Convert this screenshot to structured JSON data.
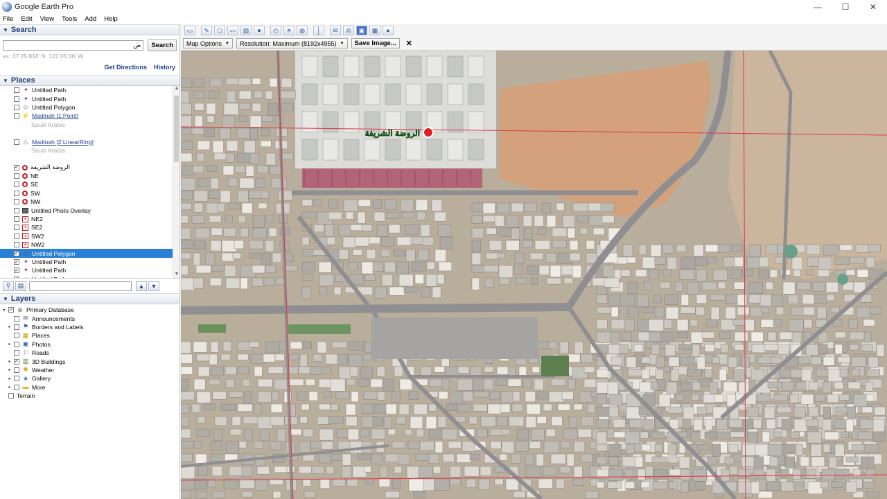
{
  "window": {
    "title": "Google Earth Pro",
    "minimize": "—",
    "maximize": "☐",
    "close": "✕"
  },
  "menu": [
    "File",
    "Edit",
    "View",
    "Tools",
    "Add",
    "Help"
  ],
  "search": {
    "header": "Search",
    "input_value": "ص",
    "button": "Search",
    "hint": "ex: 37 25.818' N, 122 05.36' W",
    "get_directions": "Get Directions",
    "history": "History"
  },
  "places": {
    "header": "Places",
    "items": [
      {
        "label": "Untitled Path",
        "icon": "path-icon",
        "checked": false,
        "style": "normal"
      },
      {
        "label": "Untitled Path",
        "icon": "path-icon",
        "checked": false,
        "style": "normal"
      },
      {
        "label": "Untitled Polygon",
        "icon": "polygon-icon",
        "checked": false,
        "style": "normal"
      },
      {
        "label": "Madinah [1:Point]",
        "icon": "point-icon",
        "checked": false,
        "style": "link"
      },
      {
        "label": "Saudi Arabia",
        "icon": "",
        "checked": null,
        "style": "gray"
      },
      {
        "label": "",
        "icon": "",
        "checked": null,
        "style": "gray"
      },
      {
        "label": "Madinah [2:LinearRing]",
        "icon": "ring-icon",
        "checked": false,
        "style": "link"
      },
      {
        "label": "Saudi Arabia",
        "icon": "",
        "checked": null,
        "style": "gray"
      },
      {
        "label": "",
        "icon": "",
        "checked": null,
        "style": "gray"
      },
      {
        "label": "الروضة الشريفة",
        "icon": "placemark-icon",
        "checked": true,
        "style": "normal"
      },
      {
        "label": "NE",
        "icon": "placemark-icon",
        "checked": false,
        "style": "normal"
      },
      {
        "label": "SE",
        "icon": "placemark-icon",
        "checked": false,
        "style": "normal"
      },
      {
        "label": "SW",
        "icon": "placemark-icon",
        "checked": false,
        "style": "normal"
      },
      {
        "label": "NW",
        "icon": "placemark-icon",
        "checked": false,
        "style": "normal"
      },
      {
        "label": "Untitled Photo Overlay",
        "icon": "photo-overlay-icon",
        "checked": false,
        "style": "normal"
      },
      {
        "label": "NE2",
        "icon": "square-marker-icon",
        "checked": false,
        "style": "normal"
      },
      {
        "label": "SE2",
        "icon": "square-marker-icon",
        "checked": false,
        "style": "normal"
      },
      {
        "label": "SW2",
        "icon": "square-marker-icon",
        "checked": false,
        "style": "normal"
      },
      {
        "label": "NW2",
        "icon": "square-marker-icon",
        "checked": false,
        "style": "normal"
      },
      {
        "label": "Untitled Polygon",
        "icon": "polygon-icon",
        "checked": true,
        "style": "selected"
      },
      {
        "label": "Untitled Path",
        "icon": "path-icon",
        "checked": true,
        "style": "normal"
      },
      {
        "label": "Untitled Path",
        "icon": "path-icon",
        "checked": true,
        "style": "normal"
      },
      {
        "label": "Untitled Path",
        "icon": "path-icon",
        "checked": true,
        "style": "normal"
      }
    ]
  },
  "layers": {
    "header": "Layers",
    "items": [
      {
        "label": "Primary Database",
        "icon": "globe-db-icon",
        "indent": 0,
        "expander": "▾",
        "checked": true
      },
      {
        "label": "Announcements",
        "icon": "mail-icon",
        "indent": 1,
        "expander": "",
        "checked": false
      },
      {
        "label": "Borders and Labels",
        "icon": "flag-icon",
        "indent": 1,
        "expander": "▸",
        "checked": false
      },
      {
        "label": "Places",
        "icon": "places-icon",
        "indent": 1,
        "expander": "",
        "checked": false
      },
      {
        "label": "Photos",
        "icon": "photo-icon",
        "indent": 1,
        "expander": "▸",
        "checked": false
      },
      {
        "label": "Roads",
        "icon": "road-icon",
        "indent": 1,
        "expander": "",
        "checked": false
      },
      {
        "label": "3D Buildings",
        "icon": "building-icon",
        "indent": 1,
        "expander": "▸",
        "checked": true
      },
      {
        "label": "Weather",
        "icon": "weather-icon",
        "indent": 1,
        "expander": "▸",
        "checked": false
      },
      {
        "label": "Gallery",
        "icon": "gallery-icon",
        "indent": 1,
        "expander": "▸",
        "checked": false
      },
      {
        "label": "More",
        "icon": "folder-icon",
        "indent": 1,
        "expander": "▸",
        "checked": false
      },
      {
        "label": "Terrain",
        "icon": "",
        "indent": 0,
        "expander": "",
        "checked": false
      }
    ]
  },
  "toolbar": {
    "buttons": [
      "hide-sidebar-icon",
      "placemark-add-icon",
      "polygon-add-icon",
      "path-add-icon",
      "overlay-add-icon",
      "tour-record-icon",
      "historical-imagery-icon",
      "sun-icon",
      "planet-icon",
      "ruler-icon",
      "email-icon",
      "print-icon",
      "save-image-icon",
      "map-view-icon",
      "earth-icon"
    ]
  },
  "save_bar": {
    "map_options": "Map Options",
    "resolution": "Resolution: Maximum (8192x4955)",
    "save_image": "Save Image...",
    "close": "✕"
  },
  "map": {
    "landmark_label": "الروضة الشريفة",
    "colors": {
      "ground": "#b9ad9b",
      "desert": "#d3a27c",
      "road": "#8f8f92",
      "line": "#e0344a",
      "mosque": "#dcdcd8",
      "plaza": "#b46478"
    }
  }
}
